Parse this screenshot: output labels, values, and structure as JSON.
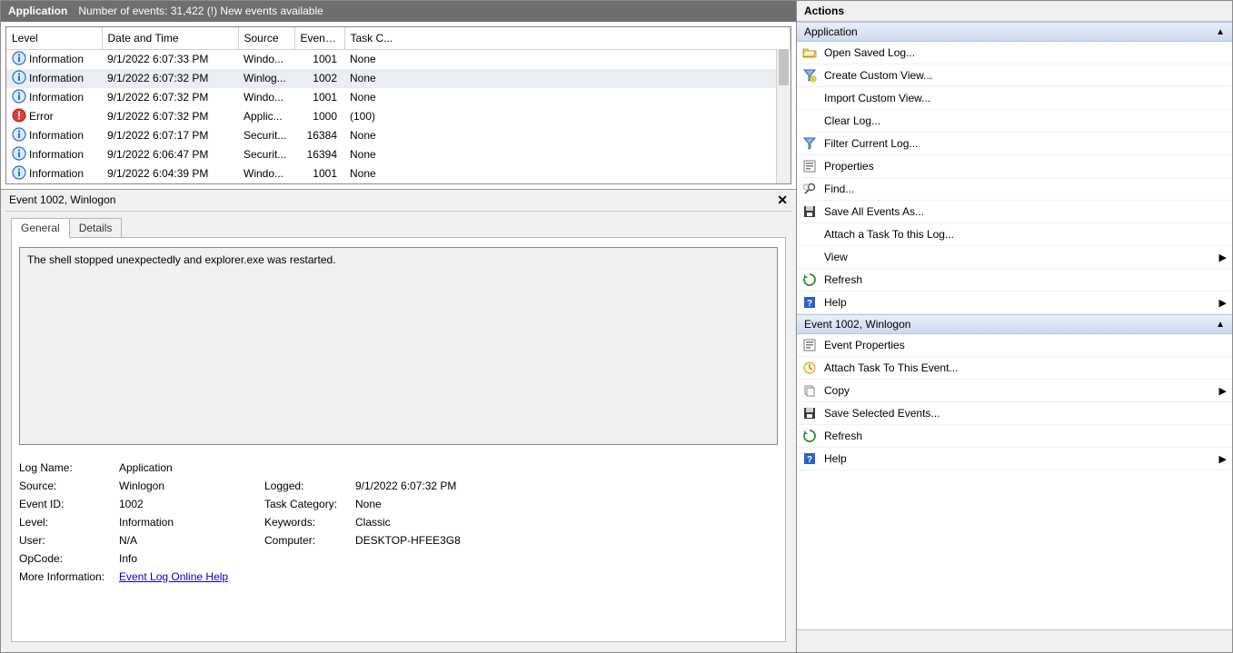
{
  "header": {
    "title": "Application",
    "subtitle": "Number of events: 31,422 (!) New events available"
  },
  "columns": {
    "level": "Level",
    "date": "Date and Time",
    "source": "Source",
    "eventid": "Event ID",
    "taskcat": "Task C..."
  },
  "events": [
    {
      "icon": "info",
      "level": "Information",
      "date": "9/1/2022 6:07:33 PM",
      "source": "Windo...",
      "eventid": "1001",
      "task": "None",
      "selected": false
    },
    {
      "icon": "info",
      "level": "Information",
      "date": "9/1/2022 6:07:32 PM",
      "source": "Winlog...",
      "eventid": "1002",
      "task": "None",
      "selected": true
    },
    {
      "icon": "info",
      "level": "Information",
      "date": "9/1/2022 6:07:32 PM",
      "source": "Windo...",
      "eventid": "1001",
      "task": "None",
      "selected": false
    },
    {
      "icon": "error",
      "level": "Error",
      "date": "9/1/2022 6:07:32 PM",
      "source": "Applic...",
      "eventid": "1000",
      "task": "(100)",
      "selected": false
    },
    {
      "icon": "info",
      "level": "Information",
      "date": "9/1/2022 6:07:17 PM",
      "source": "Securit...",
      "eventid": "16384",
      "task": "None",
      "selected": false
    },
    {
      "icon": "info",
      "level": "Information",
      "date": "9/1/2022 6:06:47 PM",
      "source": "Securit...",
      "eventid": "16394",
      "task": "None",
      "selected": false
    },
    {
      "icon": "info",
      "level": "Information",
      "date": "9/1/2022 6:04:39 PM",
      "source": "Windo...",
      "eventid": "1001",
      "task": "None",
      "selected": false
    }
  ],
  "detail": {
    "title": "Event 1002, Winlogon",
    "tabs": {
      "general": "General",
      "details": "Details"
    },
    "message": "The shell stopped unexpectedly and explorer.exe was restarted.",
    "labels": {
      "logname": "Log Name:",
      "source": "Source:",
      "eventid": "Event ID:",
      "level": "Level:",
      "user": "User:",
      "opcode": "OpCode:",
      "moreinfo": "More Information:",
      "logged": "Logged:",
      "taskcat": "Task Category:",
      "keywords": "Keywords:",
      "computer": "Computer:"
    },
    "values": {
      "logname": "Application",
      "source": "Winlogon",
      "eventid": "1002",
      "level": "Information",
      "user": "N/A",
      "opcode": "Info",
      "logged": "9/1/2022 6:07:32 PM",
      "taskcat": "None",
      "keywords": "Classic",
      "computer": "DESKTOP-HFEE3G8",
      "helplink": "Event Log Online Help"
    }
  },
  "actions": {
    "panel_title": "Actions",
    "section1_title": "Application",
    "section2_title": "Event 1002, Winlogon",
    "app_actions": [
      {
        "icon": "folder-open",
        "label": "Open Saved Log...",
        "sub": false
      },
      {
        "icon": "filter-new",
        "label": "Create Custom View...",
        "sub": false
      },
      {
        "icon": "none",
        "label": "Import Custom View...",
        "sub": false
      },
      {
        "icon": "none",
        "label": "Clear Log...",
        "sub": false
      },
      {
        "icon": "filter",
        "label": "Filter Current Log...",
        "sub": false
      },
      {
        "icon": "properties",
        "label": "Properties",
        "sub": false
      },
      {
        "icon": "find",
        "label": "Find...",
        "sub": false
      },
      {
        "icon": "save",
        "label": "Save All Events As...",
        "sub": false
      },
      {
        "icon": "none",
        "label": "Attach a Task To this Log...",
        "sub": false
      },
      {
        "icon": "none",
        "label": "View",
        "sub": true
      },
      {
        "icon": "refresh",
        "label": "Refresh",
        "sub": false
      },
      {
        "icon": "help",
        "label": "Help",
        "sub": true
      }
    ],
    "event_actions": [
      {
        "icon": "properties",
        "label": "Event Properties",
        "sub": false
      },
      {
        "icon": "attach",
        "label": "Attach Task To This Event...",
        "sub": false
      },
      {
        "icon": "copy",
        "label": "Copy",
        "sub": true
      },
      {
        "icon": "save",
        "label": "Save Selected Events...",
        "sub": false
      },
      {
        "icon": "refresh",
        "label": "Refresh",
        "sub": false
      },
      {
        "icon": "help",
        "label": "Help",
        "sub": true
      }
    ]
  }
}
